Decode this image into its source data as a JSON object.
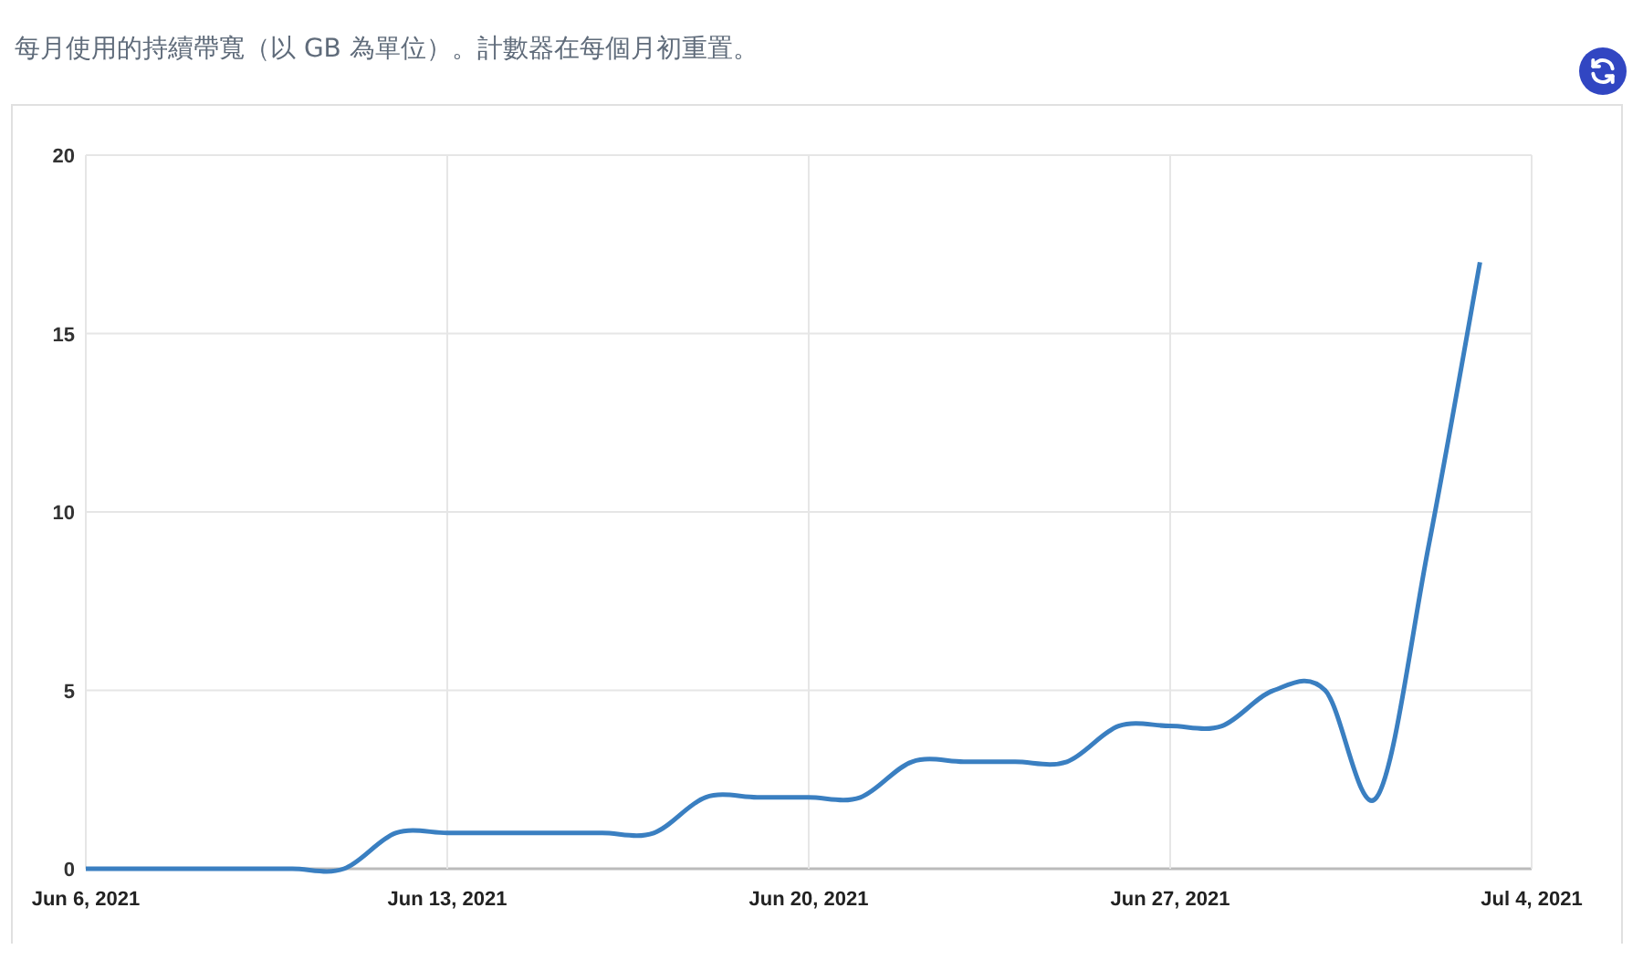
{
  "description": "每月使用的持續帶寬（以 GB 為單位）。計數器在每個月初重置。",
  "chart": {
    "chart_data": {
      "type": "line",
      "grid": true,
      "categories": [
        "Jun 6, 2021",
        null,
        null,
        null,
        null,
        null,
        null,
        "Jun 13, 2021",
        null,
        null,
        null,
        null,
        null,
        null,
        "Jun 20, 2021",
        null,
        null,
        null,
        null,
        null,
        null,
        "Jun 27, 2021",
        null,
        null,
        null,
        null,
        null,
        null,
        "Jul 4, 2021"
      ],
      "series": [
        {
          "color": "#3a7fc1",
          "values": [
            0,
            0,
            0,
            0,
            0,
            0,
            1,
            1,
            1,
            1,
            1,
            1,
            2,
            2,
            2,
            2,
            3,
            3,
            3,
            3,
            4,
            4,
            4,
            5,
            5,
            2,
            9,
            17,
            null
          ]
        }
      ],
      "ylim": [
        0,
        20
      ],
      "yticks": [
        0,
        5,
        10,
        15,
        20
      ]
    }
  }
}
